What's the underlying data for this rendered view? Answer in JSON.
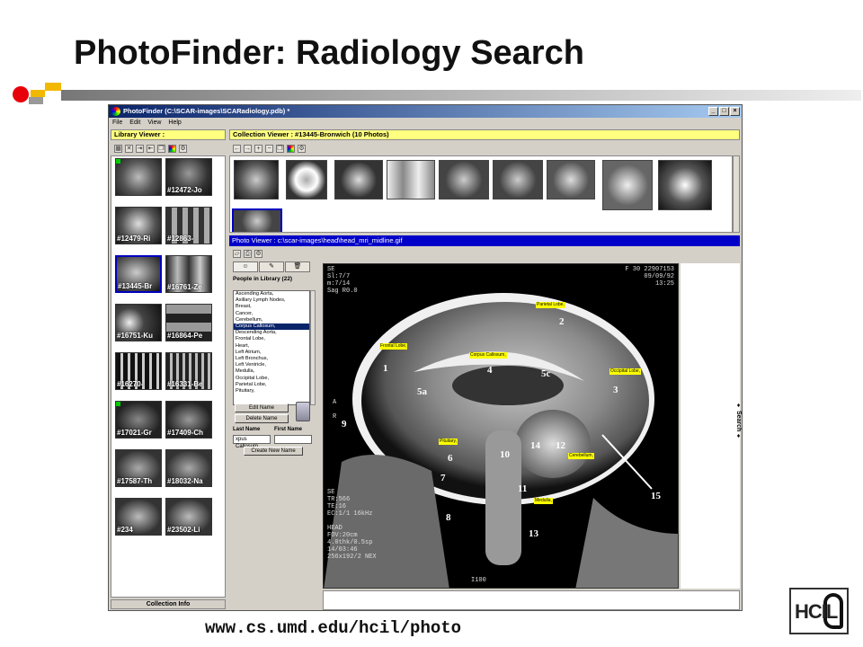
{
  "slide": {
    "title": "PhotoFinder: Radiology Search",
    "url": "www.cs.umd.edu/hcil/photo",
    "logo_text": "HCIL"
  },
  "window": {
    "title": "PhotoFinder (C:\\SCAR-images\\SCARadiology.pdb) *",
    "menu": [
      "File",
      "Edit",
      "View",
      "Help"
    ],
    "controls": [
      "_",
      "□",
      "×"
    ]
  },
  "library": {
    "header": "Library Viewer :",
    "thumbs": [
      "#12472-Jo",
      "#12479-Ri",
      "#12863-",
      "#13445-Br",
      "#16761-Ze",
      "#16751-Ku",
      "#16864-Pe",
      "#16270-",
      "#16331-Be",
      "#17021-Gr",
      "#17409-Ch",
      "#17587-Th",
      "#18032-Na",
      "#234",
      "#23502-Li"
    ],
    "footer": "Collection Info"
  },
  "collection": {
    "header": "Collection Viewer : #13445-Bronwich (10 Photos)"
  },
  "photo_viewer": {
    "header": "Photo Viewer : c:\\scar-images\\head\\head_mri_midline.gif",
    "people_title": "People in Library (22)",
    "people": [
      "Ascending Aorta,",
      "Axillary Lymph Nodes,",
      "Breast,",
      "Cancer,",
      "Cerebellum,",
      "Corpus Callosum,",
      "Descending Aorta,",
      "Frontal Lobe,",
      "Heart,",
      "Left Atrium,",
      "Left Bronchus,",
      "Left Ventricle,",
      "Medulla,",
      "Occipital Lobe,",
      "Parietal Lobe,",
      "Pituitary,"
    ],
    "selected_person": "Corpus Callosum,",
    "edit_name": "Edit Name",
    "delete_name": "Delete Name",
    "last_name_label": "Last Name",
    "first_name_label": "First Name",
    "last_name_value": "xpus Callosum",
    "create_new_name": "Create New Name",
    "search_strip": "♦ Search ♦"
  },
  "mri": {
    "top_left": "SE\nSl:7/7\nm:7/14\nSag R0.0",
    "top_right": "F 30 22907153\n09/09/92\n13:25",
    "bottom_left": "SE\nTR:566\nTE:16\nEC:1/1 16kHz\n\nHEAD\nFOV:20cm\n4.0thk/0.5sp\n14/03:46\n256x192/2 NEX",
    "bottom_center": "I100",
    "side_text": "A\n\nR",
    "labels": [
      "Parietal Lobe,",
      "Frontal Lobe,",
      "Corpus Callosum,",
      "Occipital Lobe,",
      "Pituitary,",
      "Cerebellum,",
      "Medulla,"
    ],
    "numbers": [
      "1",
      "2",
      "3",
      "4",
      "5a",
      "5c",
      "6",
      "7",
      "8",
      "9",
      "10",
      "11",
      "12",
      "13",
      "14",
      "15"
    ]
  }
}
